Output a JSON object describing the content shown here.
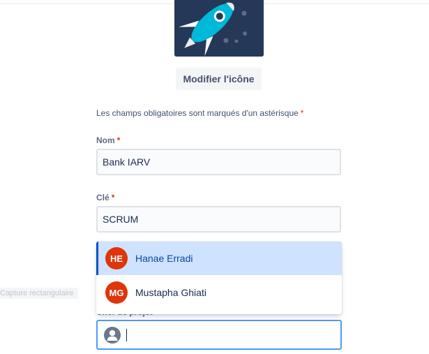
{
  "project": {
    "change_icon_label": "Modifier l'icône"
  },
  "form": {
    "required_note": "Les champs obligatoires sont marqués d'un astérisque",
    "required_marker": "*",
    "name_label": "Nom",
    "name_value": "Bank IARV",
    "key_label": "Clé",
    "key_value": "SCRUM",
    "project_lead_label": "Chef de projet",
    "project_lead_value": ""
  },
  "background_text": "Capture rectangulaire",
  "dropdown": {
    "options": [
      {
        "initials": "HE",
        "name": "Hanae Erradi",
        "highlighted": true,
        "avatar_color": "#de350b"
      },
      {
        "initials": "MG",
        "name": "Mustapha Ghiati",
        "highlighted": false,
        "avatar_color": "#de350b"
      }
    ]
  },
  "colors": {
    "accent": "#0052cc",
    "focus_border": "#4c9aff",
    "highlight_bg": "#cfe2ff",
    "avatar_bg": "#253858",
    "required": "#de350b"
  }
}
